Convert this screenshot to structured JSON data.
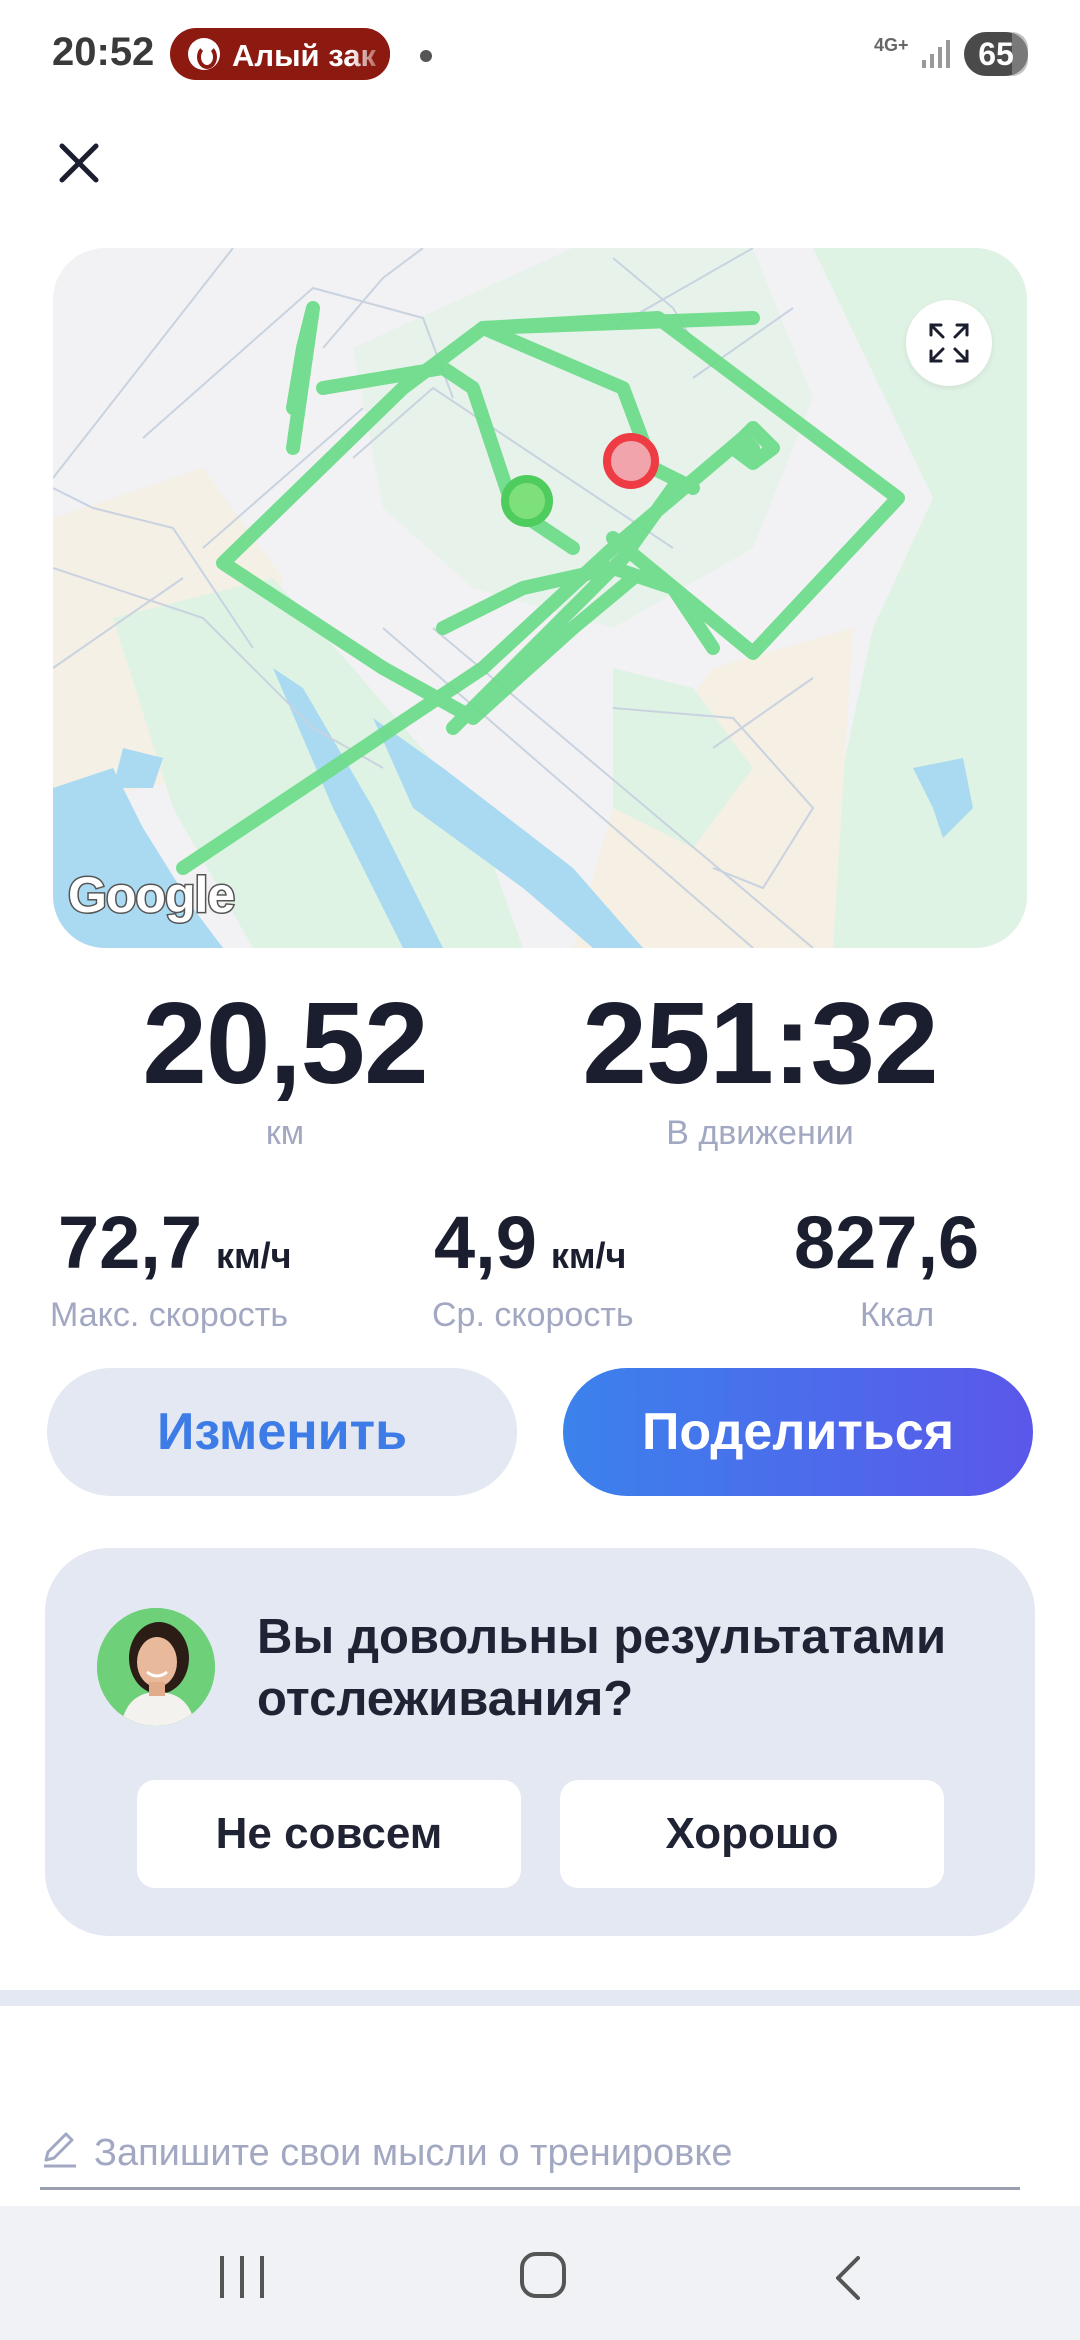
{
  "status_bar": {
    "time": "20:52",
    "media_text": "Алый зак",
    "network": "4G+",
    "battery": "65"
  },
  "map": {
    "attribution": "Google",
    "route_color": "#6fdc8c",
    "start_color": "#7ee07a",
    "end_color": "#ee3b44"
  },
  "stats": {
    "distance_value": "20,52",
    "distance_label": "км",
    "time_value": "251:32",
    "time_label": "В движении",
    "max_speed_value": "72,7",
    "max_speed_unit": "км/ч",
    "max_speed_label": "Макс. скорость",
    "avg_speed_value": "4,9",
    "avg_speed_unit": "км/ч",
    "avg_speed_label": "Ср. скорость",
    "calories_value": "827,6",
    "calories_label": "Ккал"
  },
  "actions": {
    "edit_label": "Изменить",
    "share_label": "Поделиться"
  },
  "feedback": {
    "question": "Вы довольны результатами отслеживания?",
    "no_label": "Не совсем",
    "ok_label": "Хорошо"
  },
  "notes": {
    "placeholder": "Запишите свои мысли о тренировке"
  },
  "icons": {
    "close": "close-icon",
    "expand": "expand-icon",
    "pencil": "pencil-icon",
    "recents": "recents-icon",
    "home": "home-icon",
    "back": "back-icon"
  },
  "colors": {
    "accent": "#3d7be6",
    "share_gradient_start": "#3b82ec",
    "share_gradient_end": "#5b57ea",
    "card_background": "#e3e8f2",
    "muted_text": "#a3a8c2"
  }
}
